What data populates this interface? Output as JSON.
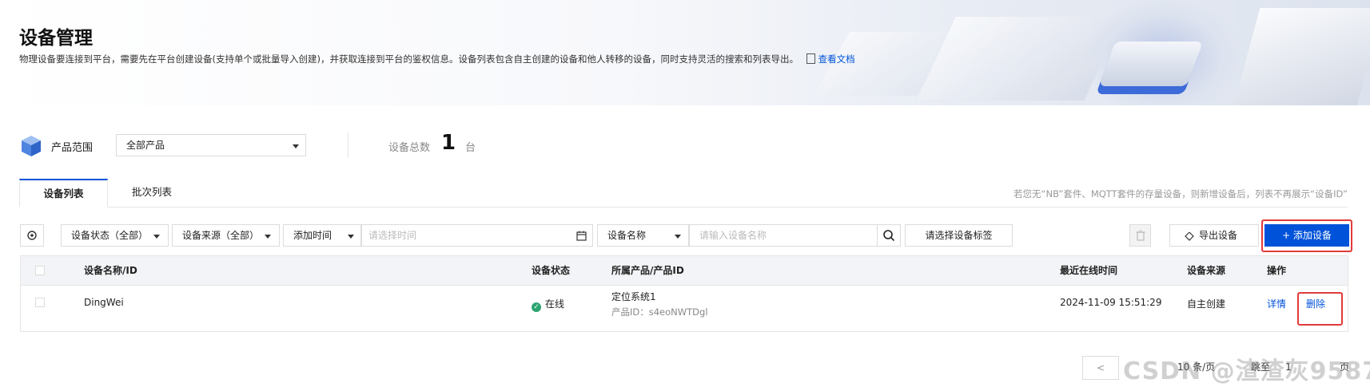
{
  "header": {
    "title": "设备管理",
    "description": "物理设备要连接到平台，需要先在平台创建设备(支持单个或批量导入创建)，并获取连接到平台的鉴权信息。设备列表包含自主创建的设备和他人转移的设备，同时支持灵活的搜索和列表导出。",
    "doc_link": "查看文档"
  },
  "product_scope": {
    "label": "产品范围",
    "selected": "全部产品",
    "count_label": "设备总数",
    "count_value": "1",
    "count_unit": "台"
  },
  "tabs": [
    {
      "label": "设备列表",
      "active": true
    },
    {
      "label": "批次列表",
      "active": false
    }
  ],
  "hint": "若您无“NB”套件、MQTT套件的存量设备，则新增设备后，列表不再展示“设备ID”",
  "filters": {
    "status": "设备状态（全部）",
    "source": "设备来源（全部）",
    "time_type": "添加时间",
    "time_placeholder": "请选择时间",
    "search_field": "设备名称",
    "search_placeholder": "请输入设备名称",
    "tag_button": "请选择设备标签",
    "export_button": "导出设备",
    "add_button": "+ 添加设备"
  },
  "table": {
    "columns": [
      "设备名称/ID",
      "设备状态",
      "所属产品/产品ID",
      "最近在线时间",
      "设备来源",
      "操作"
    ],
    "rows": [
      {
        "name": "DingWei",
        "status": "在线",
        "product": "定位系统1",
        "product_id": "产品ID：s4eoNWTDgl",
        "last_online": "2024-11-09 15:51:29",
        "source": "自主创建",
        "action_detail": "详情",
        "action_delete": "删除"
      }
    ]
  },
  "pagination": {
    "prev": "<",
    "page_size": "10 条/页",
    "jump": "跳至",
    "current": "1",
    "unit": "页"
  },
  "watermark": "CSDN @渣渣灰9587",
  "colors": {
    "primary": "#0052d9",
    "success": "#2ba471",
    "highlight": "#e23a3a"
  }
}
